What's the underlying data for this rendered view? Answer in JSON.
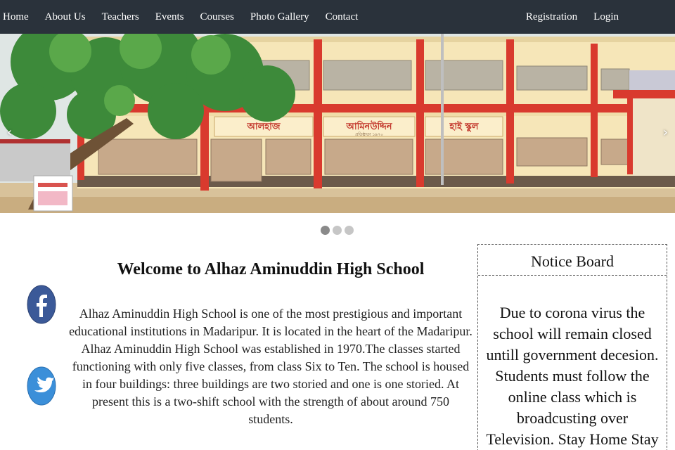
{
  "nav": {
    "left_items": [
      {
        "label": "Home"
      },
      {
        "label": "About Us"
      },
      {
        "label": "Teachers"
      },
      {
        "label": "Events"
      },
      {
        "label": "Courses"
      },
      {
        "label": "Photo Gallery"
      },
      {
        "label": "Contact"
      }
    ],
    "right_items": [
      {
        "label": "Registration"
      },
      {
        "label": "Login"
      }
    ]
  },
  "carousel": {
    "prev_glyph": "‹",
    "next_glyph": "›",
    "slide_count": 3,
    "active_index": 0,
    "banner_signs": [
      "আলহাজ",
      "আমিনউদ্দিন",
      "হাই স্কুল"
    ],
    "banner_subtitle": "প্রতিষ্ঠাতা ১৯৭০"
  },
  "welcome": {
    "title": "Welcome to Alhaz Aminuddin High School",
    "text": "Alhaz Aminuddin High School is one of the most prestigious and important educational institutions in Madaripur. It is located in the heart of the Madaripur. Alhaz Aminuddin High School was established in 1970.The classes started functioning with only five classes, from class Six to Ten. The school is housed in four buildings: three buildings are two storied and one is one storied. At present this is a two-shift school with the strength of about around 750 students."
  },
  "social": {
    "facebook_icon": "facebook-icon",
    "twitter_icon": "twitter-icon"
  },
  "notice": {
    "title": "Notice Board",
    "text": "Due to corona virus the school will remain closed untill government decesion. Students must follow the online class which is broadcusting over Television. Stay Home Stay Safe."
  },
  "colors": {
    "navbar": "#2a323b",
    "building_wall": "#f6e6b8",
    "building_pillar": "#d93a2e",
    "facebook_blue": "#3b5998",
    "twitter_blue": "#1da1f2"
  }
}
